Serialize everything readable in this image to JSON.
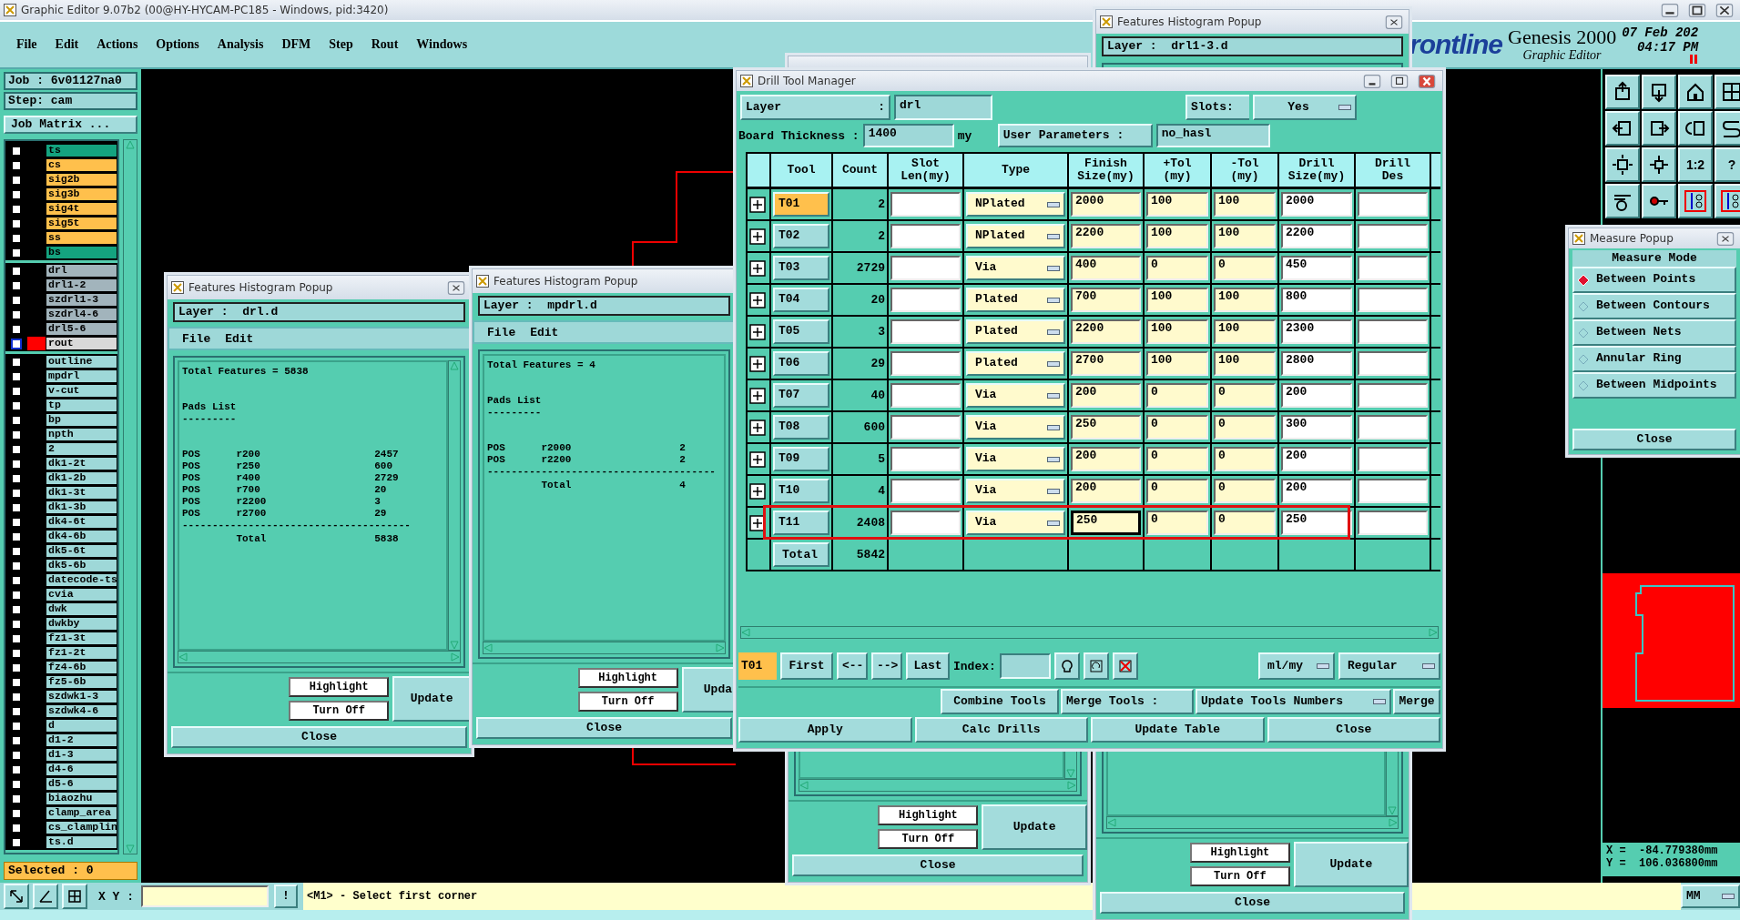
{
  "window": {
    "title": "Graphic Editor 9.07b2 (00@HY-HYCAM-PC185 - Windows, pid:3420)"
  },
  "menu": [
    "File",
    "Edit",
    "Actions",
    "Options",
    "Analysis",
    "DFM",
    "Step",
    "Rout",
    "Windows"
  ],
  "brand": {
    "logo": "rontline",
    "product": "Genesis 2000",
    "date": "07 Feb 202",
    "time": "04:17 PM",
    "subtitle": "Graphic Editor"
  },
  "job": {
    "job": "Job : 6v01127na0",
    "step": "Step: cam",
    "matrix_button": "Job Matrix ..."
  },
  "layer_groups": [
    [
      {
        "name": "ts",
        "color": "#14a37f",
        "work_layer": false,
        "checked": false
      },
      {
        "name": "cs",
        "color": "#ffc04c",
        "work_layer": false,
        "checked": false
      },
      {
        "name": "sig2b",
        "color": "#ffc04c",
        "work_layer": false,
        "checked": false
      },
      {
        "name": "sig3b",
        "color": "#ffc04c",
        "work_layer": false,
        "checked": false
      },
      {
        "name": "sig4t",
        "color": "#ffc04c",
        "work_layer": false,
        "checked": false
      },
      {
        "name": "sig5t",
        "color": "#ffc04c",
        "work_layer": false,
        "checked": false
      },
      {
        "name": "ss",
        "color": "#ffc04c",
        "work_layer": false,
        "checked": false
      },
      {
        "name": "bs",
        "color": "#14a37f",
        "work_layer": false,
        "checked": false
      }
    ],
    [
      {
        "name": "drl",
        "color": "#a2b4bc",
        "work_layer": false,
        "checked": false
      },
      {
        "name": "drl1-2",
        "color": "#a2b4bc",
        "work_layer": false,
        "checked": false
      },
      {
        "name": "szdrl1-3",
        "color": "#a2b4bc",
        "work_layer": false,
        "checked": false
      },
      {
        "name": "szdrl4-6",
        "color": "#a2b4bc",
        "work_layer": false,
        "checked": false
      },
      {
        "name": "drl5-6",
        "color": "#a2b4bc",
        "work_layer": false,
        "checked": false
      },
      {
        "name": "rout",
        "color": "#d9d9d9",
        "work_layer": true,
        "checked": false
      }
    ],
    [
      {
        "name": "outline",
        "color": "#9ed8d8",
        "work_layer": false,
        "checked": false
      },
      {
        "name": "mpdrl",
        "color": "#9ed8d8",
        "work_layer": false,
        "checked": false
      },
      {
        "name": "v-cut",
        "color": "#9ed8d8",
        "work_layer": false,
        "checked": false
      },
      {
        "name": "tp",
        "color": "#9ed8d8",
        "work_layer": false,
        "checked": false
      },
      {
        "name": "bp",
        "color": "#9ed8d8",
        "work_layer": false,
        "checked": false
      },
      {
        "name": "npth",
        "color": "#9ed8d8",
        "work_layer": false,
        "checked": false
      },
      {
        "name": "2",
        "color": "#9ed8d8",
        "work_layer": false,
        "checked": false
      },
      {
        "name": "dk1-2t",
        "color": "#9ed8d8",
        "work_layer": false,
        "checked": false
      },
      {
        "name": "dk1-2b",
        "color": "#9ed8d8",
        "work_layer": false,
        "checked": false
      },
      {
        "name": "dk1-3t",
        "color": "#9ed8d8",
        "work_layer": false,
        "checked": false
      },
      {
        "name": "dk1-3b",
        "color": "#9ed8d8",
        "work_layer": false,
        "checked": false
      },
      {
        "name": "dk4-6t",
        "color": "#9ed8d8",
        "work_layer": false,
        "checked": false
      },
      {
        "name": "dk4-6b",
        "color": "#9ed8d8",
        "work_layer": false,
        "checked": false
      },
      {
        "name": "dk5-6t",
        "color": "#9ed8d8",
        "work_layer": false,
        "checked": false
      },
      {
        "name": "dk5-6b",
        "color": "#9ed8d8",
        "work_layer": false,
        "checked": false
      },
      {
        "name": "datecode-ts",
        "color": "#9ed8d8",
        "work_layer": false,
        "checked": false
      },
      {
        "name": "cvia",
        "color": "#9ed8d8",
        "work_layer": false,
        "checked": false
      },
      {
        "name": "dwk",
        "color": "#9ed8d8",
        "work_layer": false,
        "checked": false
      },
      {
        "name": "dwkby",
        "color": "#9ed8d8",
        "work_layer": false,
        "checked": false
      },
      {
        "name": "fz1-3t",
        "color": "#9ed8d8",
        "work_layer": false,
        "checked": false
      },
      {
        "name": "fz1-2t",
        "color": "#9ed8d8",
        "work_layer": false,
        "checked": false
      },
      {
        "name": "fz4-6b",
        "color": "#9ed8d8",
        "work_layer": false,
        "checked": false
      },
      {
        "name": "fz5-6b",
        "color": "#9ed8d8",
        "work_layer": false,
        "checked": false
      },
      {
        "name": "szdwk1-3",
        "color": "#9ed8d8",
        "work_layer": false,
        "checked": false
      },
      {
        "name": "szdwk4-6",
        "color": "#9ed8d8",
        "work_layer": false,
        "checked": false
      },
      {
        "name": "d",
        "color": "#9ed8d8",
        "work_layer": false,
        "checked": false
      },
      {
        "name": "d1-2",
        "color": "#9ed8d8",
        "work_layer": false,
        "checked": false
      },
      {
        "name": "d1-3",
        "color": "#9ed8d8",
        "work_layer": false,
        "checked": false
      },
      {
        "name": "d4-6",
        "color": "#9ed8d8",
        "work_layer": false,
        "checked": false
      },
      {
        "name": "d5-6",
        "color": "#9ed8d8",
        "work_layer": false,
        "checked": false
      },
      {
        "name": "biaozhu",
        "color": "#9ed8d8",
        "work_layer": false,
        "checked": false
      },
      {
        "name": "clamp_area",
        "color": "#9ed8d8",
        "work_layer": false,
        "checked": false
      },
      {
        "name": "cs_clamplin",
        "color": "#9ed8d8",
        "work_layer": false,
        "checked": false
      },
      {
        "name": "ts.d",
        "color": "#9ed8d8",
        "work_layer": false,
        "checked": false
      }
    ]
  ],
  "selected_count": "Selected : 0",
  "status_bar": {
    "xy_label": "X Y :",
    "alert_button": "!",
    "message": "<M1> - Select first corner",
    "units": "MM"
  },
  "toolbar_labels": [
    "1:2",
    "?"
  ],
  "histogram_popups": [
    {
      "title": "Features Histogram Popup",
      "layer": "Layer :  drl.d",
      "menu": [
        "File",
        "Edit"
      ],
      "summary": "Total Features = 5838",
      "section_title": "Pads List",
      "section_rule": "---------",
      "rows": [
        "POS      r200                   2457",
        "POS      r250                   600",
        "POS      r400                   2729",
        "POS      r700                   20",
        "POS      r2200                  3",
        "POS      r2700                  29"
      ],
      "rule": "--------------------------------------",
      "total_line": "         Total                  5838",
      "highlight": "Highlight",
      "turn_off": "Turn Off",
      "update": "Update",
      "close": "Close"
    },
    {
      "title": "Features Histogram Popup",
      "layer": "Layer :  mpdrl.d",
      "menu": [
        "File",
        "Edit"
      ],
      "summary": "Total Features = 4",
      "section_title": "Pads List",
      "section_rule": "---------",
      "rows": [
        "POS      r2000                  2",
        "POS      r2200                  2"
      ],
      "rule": "--------------------------------------",
      "total_line": "         Total                  4",
      "highlight": "Highlight",
      "turn_off": "Turn Off",
      "update": "Upda",
      "close": "Close"
    },
    {
      "highlight": "Highlight",
      "turn_off": "Turn Off",
      "update": "Update",
      "close": "Close"
    },
    {
      "title": "Features Histogram Popup",
      "layer": "Layer :  drl1-3.d",
      "highlight": "Highlight",
      "turn_off": "Turn Off",
      "update": "Update",
      "close": "Close"
    }
  ],
  "drill_tool_manager": {
    "title": "Drill Tool Manager",
    "layer_label": "Layer",
    "layer_sep": ":",
    "layer": "drl",
    "slots_label": "Slots:",
    "slots": "Yes",
    "thickness_label": "Board Thickness :",
    "thickness": "1400",
    "thickness_unit": "my",
    "params_label": "User Parameters :",
    "params": "no_hasl",
    "columns": [
      "Tool",
      "Count",
      "Slot\nLen(my)",
      "Type",
      "Finish\nSize(my)",
      "+Tol\n(my)",
      "-Tol\n(my)",
      "Drill\nSize(my)",
      "Drill\nDes"
    ],
    "rows": [
      {
        "tool": "T01",
        "count": "2",
        "type": "NPlated",
        "finish": "2000",
        "plus_tol": "100",
        "minus_tol": "100",
        "drill_size": "2000",
        "selected": true,
        "annotated": false,
        "focused": false
      },
      {
        "tool": "T02",
        "count": "2",
        "type": "NPlated",
        "finish": "2200",
        "plus_tol": "100",
        "minus_tol": "100",
        "drill_size": "2200",
        "selected": false,
        "annotated": false,
        "focused": false
      },
      {
        "tool": "T03",
        "count": "2729",
        "type": "Via",
        "finish": "400",
        "plus_tol": "0",
        "minus_tol": "0",
        "drill_size": "450",
        "selected": false,
        "annotated": false,
        "focused": false
      },
      {
        "tool": "T04",
        "count": "20",
        "type": "Plated",
        "finish": "700",
        "plus_tol": "100",
        "minus_tol": "100",
        "drill_size": "800",
        "selected": false,
        "annotated": false,
        "focused": false
      },
      {
        "tool": "T05",
        "count": "3",
        "type": "Plated",
        "finish": "2200",
        "plus_tol": "100",
        "minus_tol": "100",
        "drill_size": "2300",
        "selected": false,
        "annotated": false,
        "focused": false
      },
      {
        "tool": "T06",
        "count": "29",
        "type": "Plated",
        "finish": "2700",
        "plus_tol": "100",
        "minus_tol": "100",
        "drill_size": "2800",
        "selected": false,
        "annotated": false,
        "focused": false
      },
      {
        "tool": "T07",
        "count": "40",
        "type": "Via",
        "finish": "200",
        "plus_tol": "0",
        "minus_tol": "0",
        "drill_size": "200",
        "selected": false,
        "annotated": false,
        "focused": false
      },
      {
        "tool": "T08",
        "count": "600",
        "type": "Via",
        "finish": "250",
        "plus_tol": "0",
        "minus_tol": "0",
        "drill_size": "300",
        "selected": false,
        "annotated": false,
        "focused": false
      },
      {
        "tool": "T09",
        "count": "5",
        "type": "Via",
        "finish": "200",
        "plus_tol": "0",
        "minus_tol": "0",
        "drill_size": "200",
        "selected": false,
        "annotated": false,
        "focused": false
      },
      {
        "tool": "T10",
        "count": "4",
        "type": "Via",
        "finish": "200",
        "plus_tol": "0",
        "minus_tol": "0",
        "drill_size": "200",
        "selected": false,
        "annotated": false,
        "focused": false
      },
      {
        "tool": "T11",
        "count": "2408",
        "type": "Via",
        "finish": "250",
        "plus_tol": "0",
        "minus_tol": "0",
        "drill_size": "250",
        "selected": false,
        "annotated": true,
        "focused": true
      }
    ],
    "total_label": "Total",
    "total": "5842",
    "nav": {
      "current": "T01",
      "first": "First",
      "prev": "<--",
      "next": "-->",
      "last": "Last",
      "index_label": "Index:",
      "units": "ml/my",
      "mode": "Regular"
    },
    "actions": {
      "combine": "Combine Tools",
      "merge_label": "Merge Tools :",
      "update_numbers": "Update Tools Numbers",
      "merge": "Merge"
    },
    "buttons": [
      "Apply",
      "Calc Drills",
      "Update Table",
      "Close"
    ]
  },
  "measure_popup": {
    "title": "Measure Popup",
    "header": "Measure Mode",
    "options": [
      {
        "label": "Between Points",
        "selected": true
      },
      {
        "label": "Between Contours",
        "selected": false
      },
      {
        "label": "Between Nets",
        "selected": false
      },
      {
        "label": "Annular Ring",
        "selected": false
      },
      {
        "label": "Between Midpoints",
        "selected": false
      }
    ],
    "close": "Close"
  },
  "coordinates": [
    "X =  -84.779380mm",
    "Y =  106.036800mm"
  ]
}
